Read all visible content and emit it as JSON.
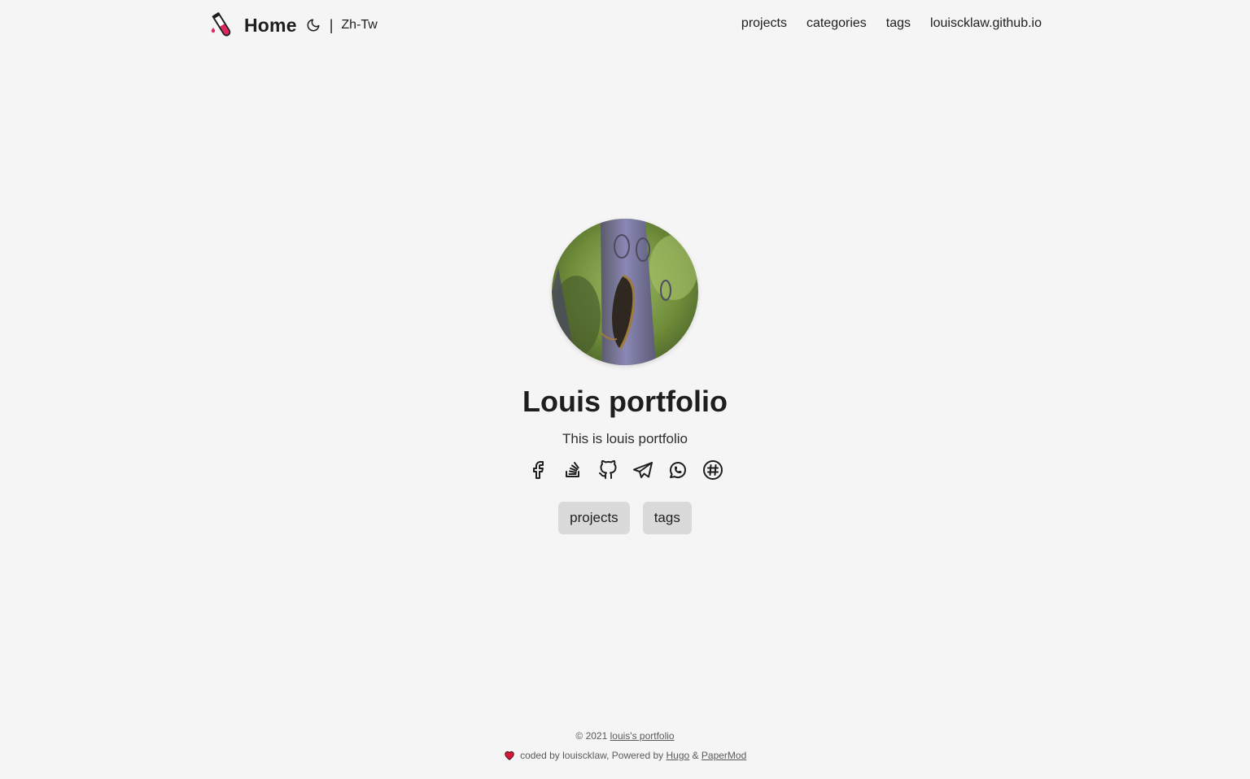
{
  "header": {
    "site_title": "Home",
    "separator": "|",
    "language": "Zh-Tw",
    "nav": [
      "projects",
      "categories",
      "tags",
      "louiscklaw.github.io"
    ]
  },
  "profile": {
    "title": "Louis portfolio",
    "subtitle": "This is louis portfolio",
    "social_icons": [
      "facebook-icon",
      "stackoverflow-icon",
      "github-icon",
      "telegram-icon",
      "whatsapp-icon",
      "slack-icon"
    ],
    "buttons": [
      "projects",
      "tags"
    ]
  },
  "footer": {
    "copyright": "© 2021",
    "site_link": "louis's portfolio",
    "coded_by": "coded by louiscklaw, Powered by",
    "hugo": "Hugo",
    "amp": "&",
    "papermod": "PaperMod"
  },
  "colors": {
    "background": "#f5f5f5",
    "button_bg": "#dadada",
    "text": "#1e1e1e",
    "heart": "#d6173a"
  }
}
